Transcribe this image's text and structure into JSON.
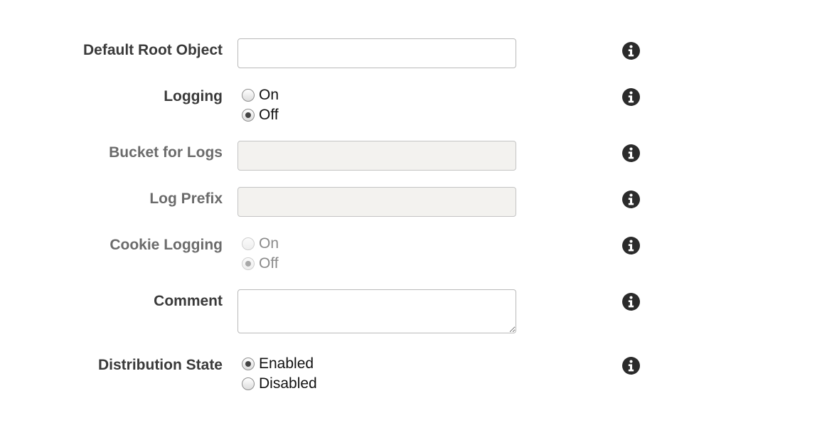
{
  "fields": {
    "default_root_object": {
      "label": "Default Root Object",
      "value": ""
    },
    "logging": {
      "label": "Logging",
      "options": [
        "On",
        "Off"
      ],
      "selected": "Off"
    },
    "bucket_for_logs": {
      "label": "Bucket for Logs",
      "value": "",
      "disabled": true
    },
    "log_prefix": {
      "label": "Log Prefix",
      "value": "",
      "disabled": true
    },
    "cookie_logging": {
      "label": "Cookie Logging",
      "options": [
        "On",
        "Off"
      ],
      "selected": "Off",
      "disabled": true
    },
    "comment": {
      "label": "Comment",
      "value": ""
    },
    "distribution_state": {
      "label": "Distribution State",
      "options": [
        "Enabled",
        "Disabled"
      ],
      "selected": "Enabled"
    }
  },
  "icons": {
    "help": "info-circle-icon",
    "color": "#2b2b2b"
  }
}
